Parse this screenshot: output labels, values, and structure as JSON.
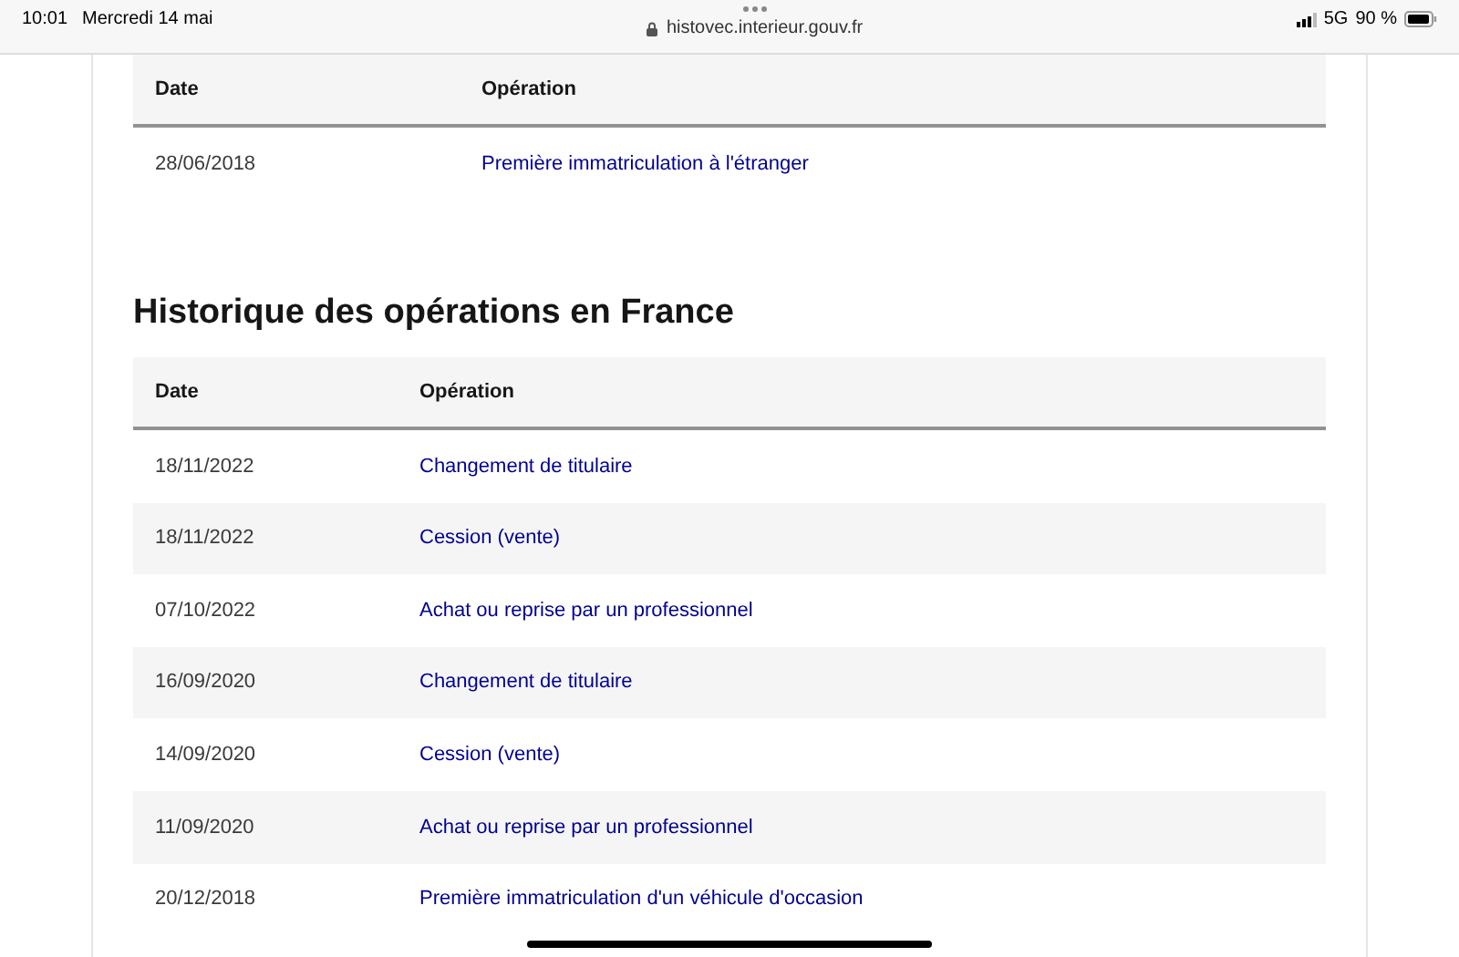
{
  "status_bar": {
    "time": "10:01",
    "date": "Mercredi 14 mai",
    "url": "histovec.interieur.gouv.fr",
    "network": "5G",
    "battery": "90 %"
  },
  "foreign_table": {
    "columns": [
      "Date",
      "Opération"
    ],
    "rows": [
      {
        "date": "28/06/2018",
        "operation": "Première immatriculation à l'étranger"
      }
    ]
  },
  "france_section": {
    "title": "Historique des opérations en France",
    "columns": [
      "Date",
      "Opération"
    ],
    "rows": [
      {
        "date": "18/11/2022",
        "operation": "Changement de titulaire"
      },
      {
        "date": "18/11/2022",
        "operation": "Cession (vente)"
      },
      {
        "date": "07/10/2022",
        "operation": "Achat ou reprise par un professionnel"
      },
      {
        "date": "16/09/2020",
        "operation": "Changement de titulaire"
      },
      {
        "date": "14/09/2020",
        "operation": "Cession (vente)"
      },
      {
        "date": "11/09/2020",
        "operation": "Achat ou reprise par un professionnel"
      },
      {
        "date": "20/12/2018",
        "operation": "Première immatriculation d'un véhicule d'occasion"
      }
    ]
  }
}
